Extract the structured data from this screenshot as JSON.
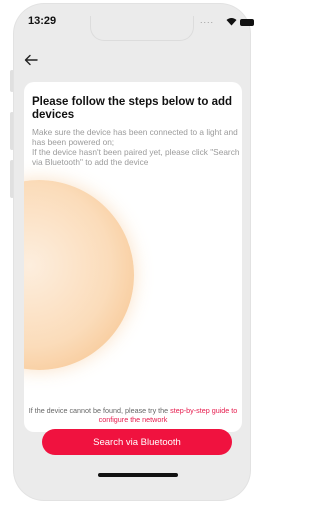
{
  "status_bar": {
    "time": "13:29",
    "signal_dots": "...."
  },
  "page": {
    "title": "Please follow the steps below to add devices",
    "description_line1": "Make sure the device has been connected to a light and has been powered on;",
    "description_line2": "If the device hasn't been paired yet, please click \"Search via Bluetooth\" to add the device"
  },
  "footer": {
    "hint_text": "If the device cannot be found, please try the ",
    "hint_link": "step-by-step guide to configure the network",
    "search_button": "Search via Bluetooth"
  },
  "colors": {
    "accent": "#f0123f",
    "link": "#e6194b",
    "glow": "#f7c794"
  },
  "icons": {
    "back": "arrow-left-icon",
    "wifi": "wifi-icon",
    "battery": "battery-icon"
  }
}
